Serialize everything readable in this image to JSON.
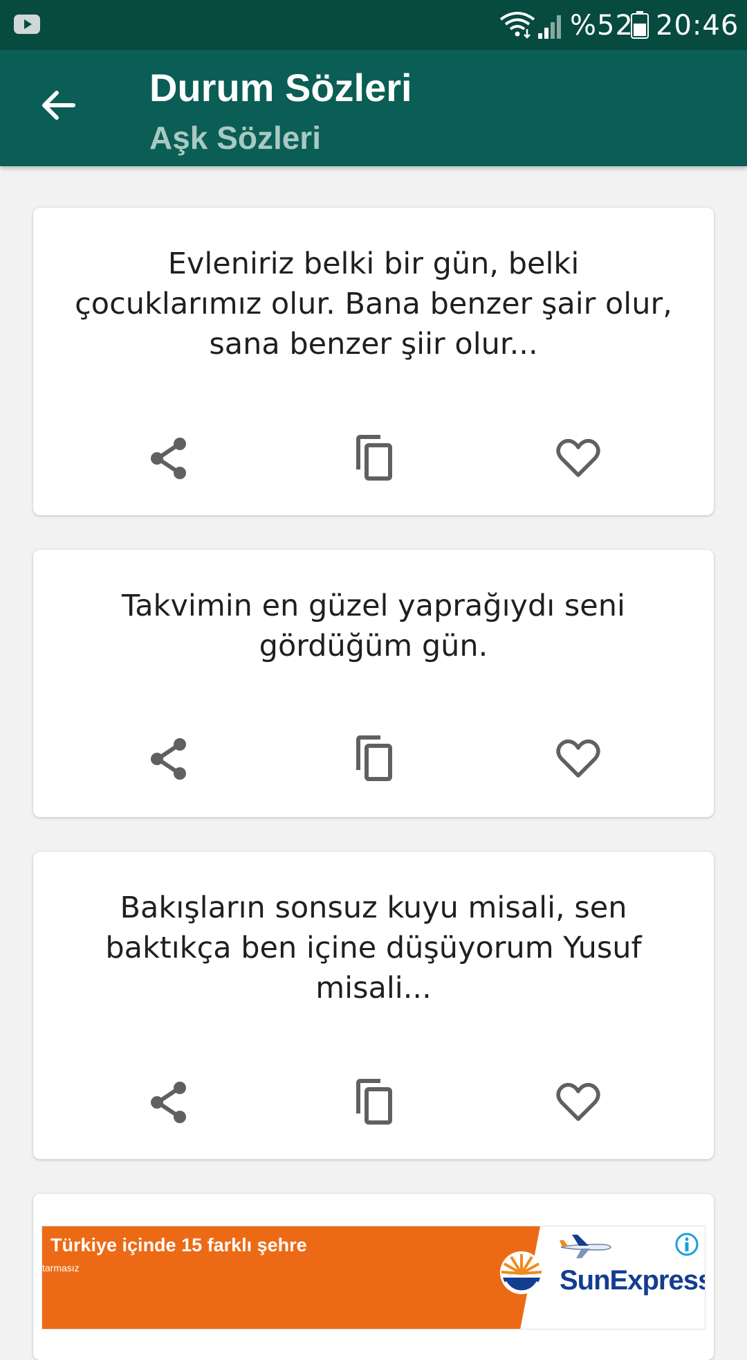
{
  "status_bar": {
    "battery": "%52",
    "time": "20:46",
    "icons": [
      "youtube-icon",
      "wifi-icon",
      "signal-icon",
      "battery-icon"
    ]
  },
  "app_bar": {
    "title": "Durum Sözleri",
    "subtitle": "Aşk Sözleri",
    "back_icon": "arrow-back-icon"
  },
  "quotes": [
    {
      "text": "Evleniriz belki bir gün, belki çocuklarımız olur. Bana benzer şair olur, sana benzer şiir olur..."
    },
    {
      "text": "Takvimin en güzel yaprağıydı seni gördüğüm gün."
    },
    {
      "text": "Bakışların sonsuz kuyu misali, sen baktıkça ben içine düşüyorum Yusuf misali..."
    }
  ],
  "card_actions": [
    "share-icon",
    "copy-icon",
    "favorite-icon"
  ],
  "ad": {
    "headline": "Türkiye içinde 15 farklı şehre",
    "small_text": "tarmasız",
    "brand": "SunExpress"
  },
  "colors": {
    "status_bar": "#064a40",
    "app_bar": "#0a5e55",
    "subtitle": "#a9c9c2",
    "background": "#f2f2f2",
    "icon_gray": "#606060",
    "ad_orange": "#ec6a15",
    "ad_brand": "#123e8f"
  }
}
